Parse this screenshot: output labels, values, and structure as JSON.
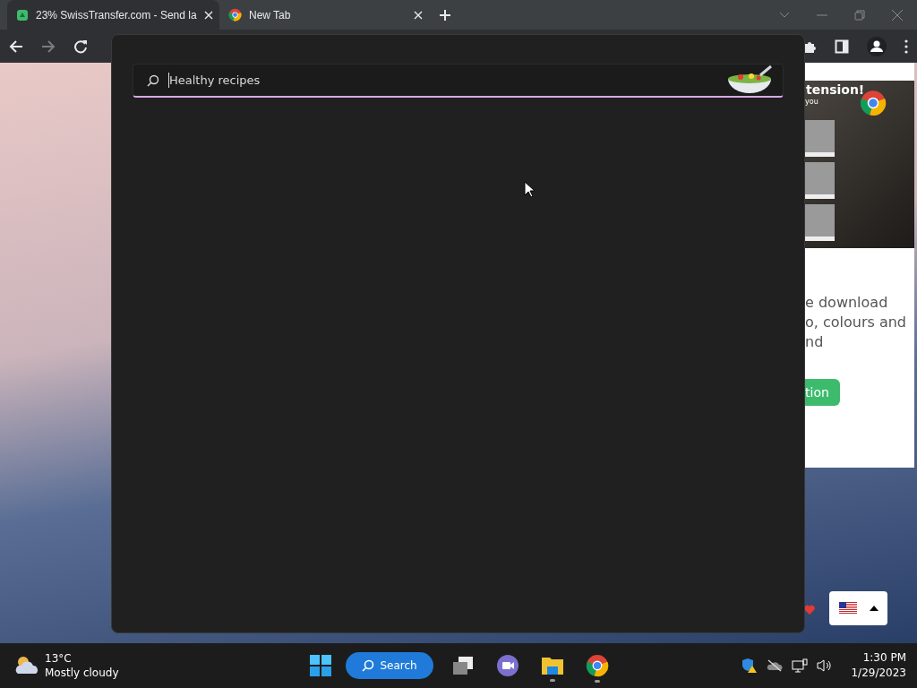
{
  "browser": {
    "tabs": [
      {
        "title": "23% SwissTransfer.com - Send la",
        "kind": "transfer",
        "selected": true
      },
      {
        "title": "New Tab",
        "kind": "chrome",
        "selected": false
      }
    ],
    "toolbar": {
      "forward_disabled": true
    }
  },
  "page": {
    "heading": "tension!",
    "subheading": "you",
    "lines": [
      "e download",
      "o, colours and",
      "nd"
    ],
    "button": "tion"
  },
  "search_flyout": {
    "value": "Healthy recipes"
  },
  "taskbar": {
    "weather": {
      "temperature": "13°C",
      "condition": "Mostly cloudy"
    },
    "search_label": "Search",
    "apps": [
      {
        "kind": "taskview",
        "running": false
      },
      {
        "kind": "chat",
        "running": false
      },
      {
        "kind": "explorer",
        "running": true
      },
      {
        "kind": "chrome",
        "running": true
      }
    ],
    "time": "1:30 PM",
    "date": "1/29/2023"
  }
}
